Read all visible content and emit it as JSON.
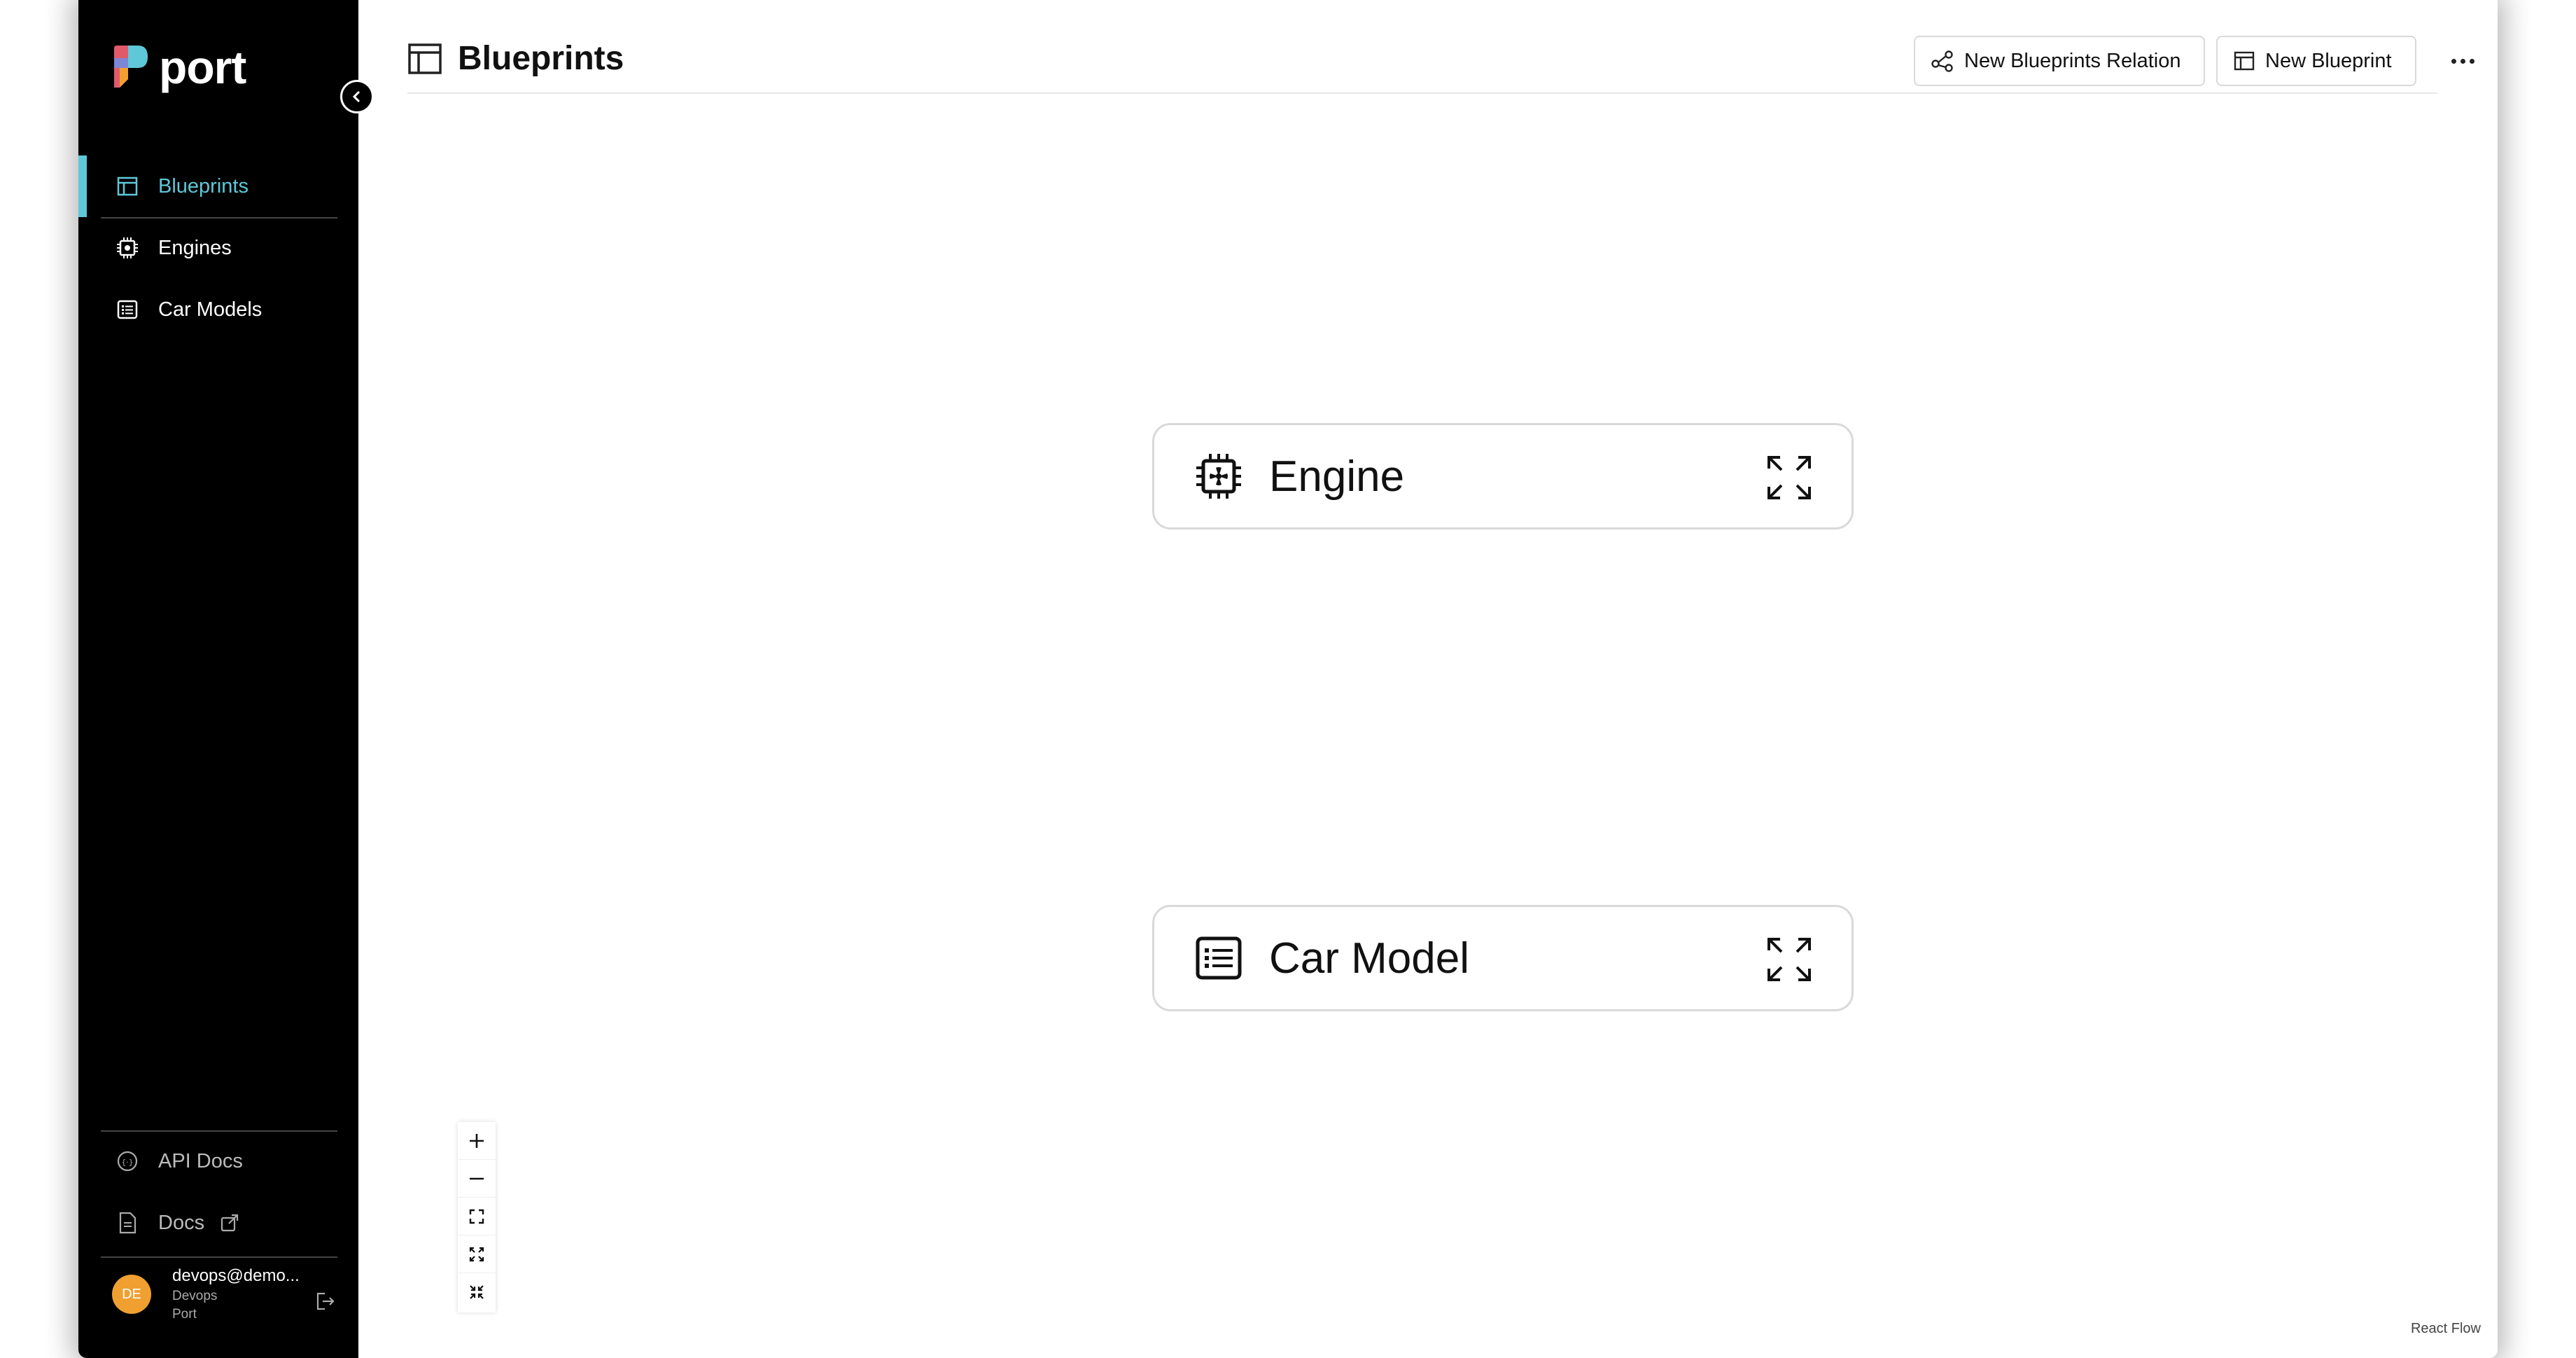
{
  "app": {
    "brand": "port"
  },
  "sidebar": {
    "items": [
      {
        "label": "Blueprints",
        "icon": "blueprint-icon",
        "active": true
      },
      {
        "label": "Engines",
        "icon": "chip-icon",
        "active": false
      },
      {
        "label": "Car Models",
        "icon": "list-icon",
        "active": false
      }
    ],
    "bottom_items": [
      {
        "label": "API Docs",
        "icon": "api-icon"
      },
      {
        "label": "Docs",
        "icon": "document-icon"
      }
    ],
    "user": {
      "initials": "DE",
      "email": "devops@demo...",
      "role": "Devops",
      "org": "Port"
    }
  },
  "header": {
    "title": "Blueprints",
    "new_relation_label": "New Blueprints Relation",
    "new_blueprint_label": "New Blueprint"
  },
  "canvas": {
    "nodes": [
      {
        "label": "Engine",
        "icon": "chip-icon"
      },
      {
        "label": "Car Model",
        "icon": "list-icon"
      }
    ],
    "attribution": "React Flow"
  },
  "colors": {
    "accent": "#5ec8d8",
    "sidebar_bg": "#000000",
    "avatar": "#f0a030"
  }
}
